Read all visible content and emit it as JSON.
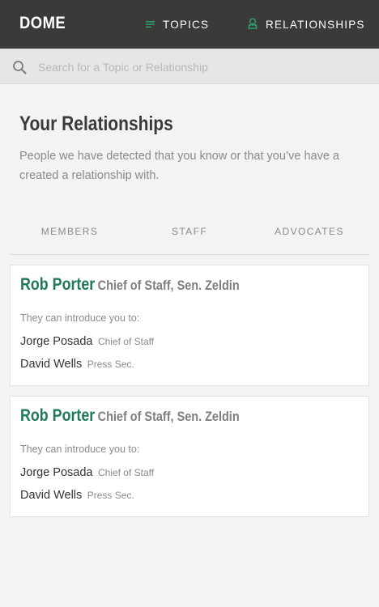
{
  "header": {
    "brand": "DOME",
    "nav": [
      {
        "label": "TOPICS",
        "icon": "topics-lines-icon"
      },
      {
        "label": "RELATIONSHIPS",
        "icon": "person-icon"
      }
    ],
    "accent": "#2e9a6a",
    "background": "#3a3a39"
  },
  "search": {
    "placeholder": "Search for a Topic or Relationship",
    "icon": "search-icon"
  },
  "main": {
    "title": "Your Relationships",
    "subtitle": "People we have detected that you know or that you’ve have a created a relationship with.",
    "tabs": [
      "MEMBERS",
      "STAFF",
      "ADVOCATES"
    ]
  },
  "cards": [
    {
      "name": "Rob Porter",
      "role": "Chief of Staff, Sen. Zeldin",
      "intro": "They can introduce you to:",
      "contacts": [
        {
          "name": "Jorge Posada",
          "role": "Chief of Staff"
        },
        {
          "name": "David Wells",
          "role": "Press Sec."
        }
      ]
    },
    {
      "name": "Rob Porter",
      "role": "Chief of Staff, Sen. Zeldin",
      "intro": "They can introduce you to:",
      "contacts": [
        {
          "name": "Jorge Posada",
          "role": "Chief of Staff"
        },
        {
          "name": "David Wells",
          "role": "Press Sec."
        }
      ]
    }
  ],
  "colors": {
    "name_green": "#1f7a55",
    "page_bg": "#f3f3f1"
  }
}
